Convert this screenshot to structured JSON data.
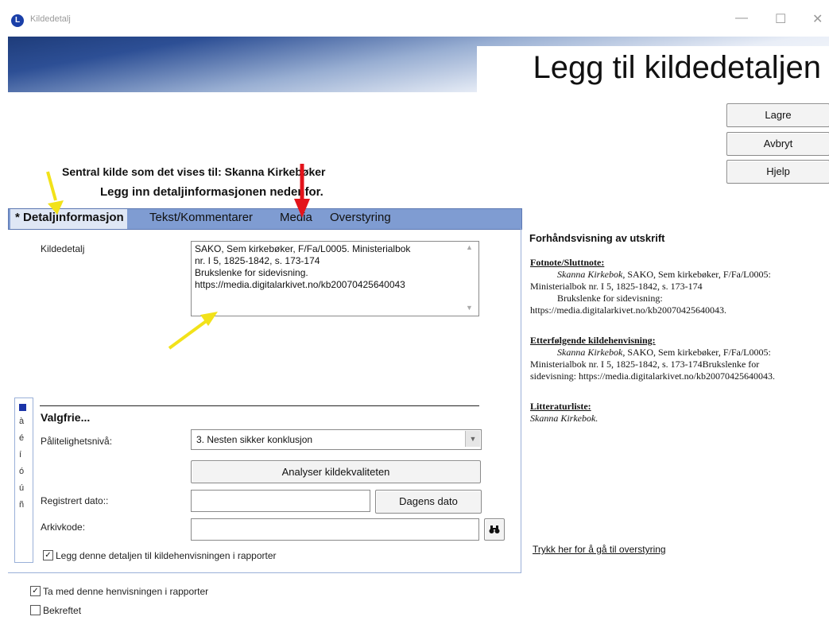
{
  "window": {
    "title": "Kildedetalj",
    "icon_letter": "L",
    "minimize": "—",
    "maximize": "☐",
    "close": "✕"
  },
  "header": {
    "heading": "Legg til kildedetaljen"
  },
  "buttons": {
    "save": "Lagre",
    "cancel": "Avbryt",
    "help": "Hjelp"
  },
  "instructions": {
    "line1": "Sentral kilde som det vises til: Skanna Kirkebøker",
    "line2": "Legg inn detaljinformasjonen nedenfor."
  },
  "tabs": [
    {
      "label": "Detaljinformasjon",
      "prefix": "*",
      "active": true
    },
    {
      "label": "Tekst/Kommentarer",
      "active": false
    },
    {
      "label": "Media",
      "active": false
    },
    {
      "label": "Overstyring",
      "active": false
    }
  ],
  "details": {
    "source_label": "Kildedetalj",
    "source_lines": [
      "SAKO, Sem kirkebøker, F/Fa/L0005. Ministerialbok",
      "nr. I 5, 1825-1842, s. 173-174",
      "Brukslenke for sidevisning.",
      "https://media.digitalarkivet.no/kb20070425640043"
    ],
    "optional_title": "Valgfrie...",
    "reliability_label": "Pålitelighetsnivå:",
    "reliability_value": "3.  Nesten sikker konklusjon",
    "analyse_button": "Analyser kildekvaliteten",
    "date_label": "Registrert dato::",
    "date_value": "",
    "today_button": "Dagens dato",
    "archive_label": "Arkivkode:",
    "archive_value": "",
    "binoculars_icon": "binoculars-icon",
    "add_to_reports": "Legg denne detaljen til kildehenvisningen i rapporter",
    "add_to_reports_checked": true
  },
  "special_chars": [
    "à",
    "é",
    "í",
    "ó",
    "ú",
    "ñ"
  ],
  "footer": {
    "include_in_reports": "Ta med denne henvisningen i rapporter",
    "include_checked": true,
    "confirmed": "Bekreftet",
    "confirmed_checked": false
  },
  "preview": {
    "title": "Forhåndsvisning av utskrift",
    "footnote_heading": "Fotnote/Sluttnote:",
    "footnote_italic": "Skanna Kirkebok,",
    "footnote_text1": " SAKO, Sem kirkebøker, F/Fa/L0005:",
    "footnote_text2": "Ministerialbok nr. I 5, 1825-1842, s. 173-174",
    "footnote_text3": "Brukslenke for sidevisning:",
    "footnote_text4": "https://media.digitalarkivet.no/kb20070425640043.",
    "subsequent_heading": "Etterfølgende kildehenvisning:",
    "subsequent_italic": "Skanna Kirkebok,",
    "subsequent_text1": " SAKO, Sem kirkebøker, F/Fa/L0005:",
    "subsequent_text2": "Ministerialbok nr. I 5, 1825-1842, s. 173-174Brukslenke for",
    "subsequent_text3": "sidevisning: https://media.digitalarkivet.no/kb20070425640043.",
    "literature_heading": "Litteraturliste:",
    "literature_text": "Skanna Kirkebok.",
    "override_link": "Trykk her for å gå til overstyring"
  },
  "colors": {
    "tab_strip": "#7f9cd2",
    "banner_dark": "#1e3c7a",
    "arrow_yellow": "#f2e21a",
    "arrow_red": "#e3141b"
  }
}
